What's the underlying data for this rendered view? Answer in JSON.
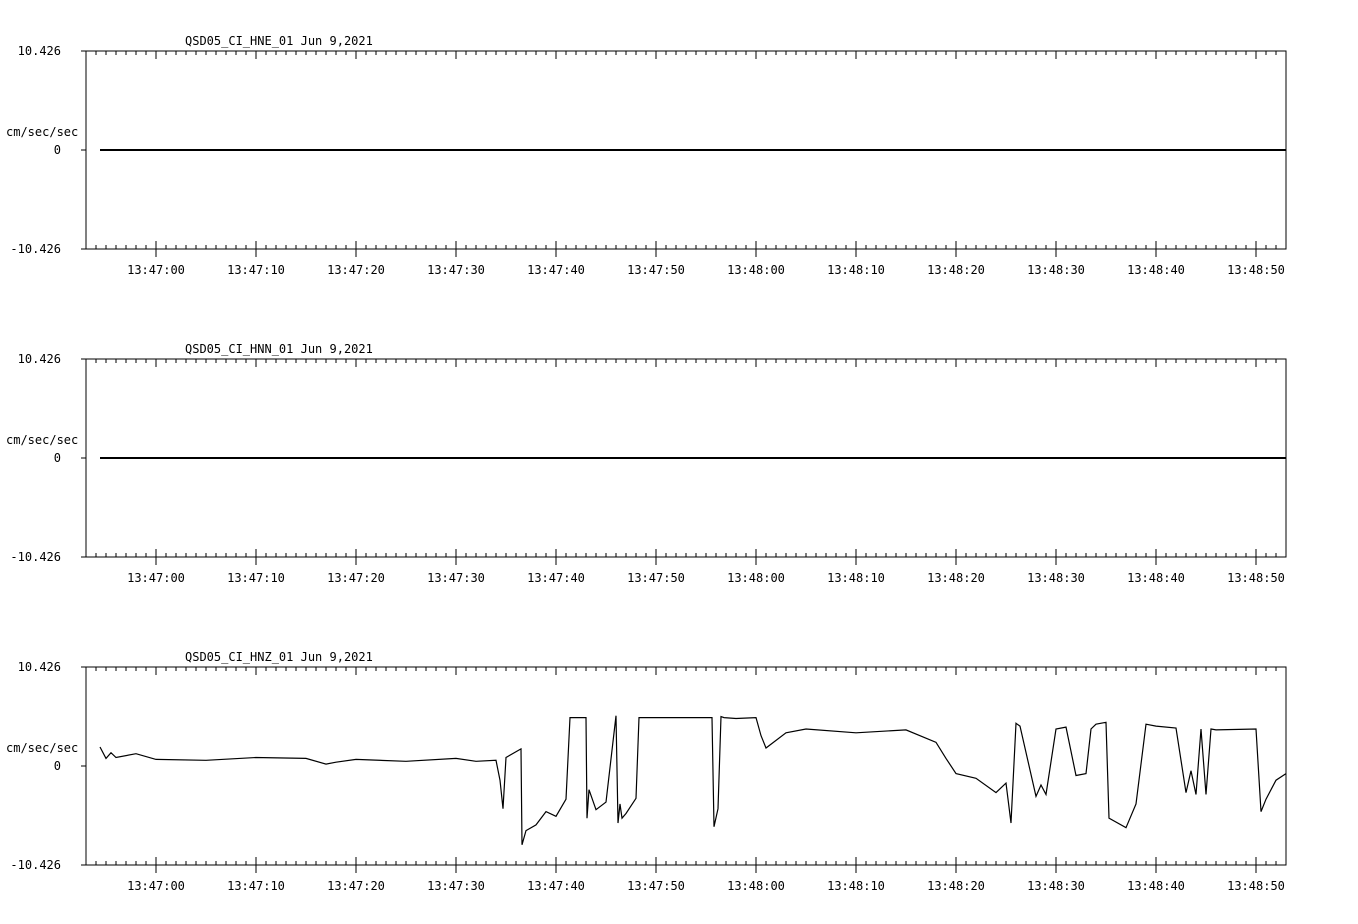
{
  "chart_data": [
    {
      "type": "line",
      "title": "QSD05_CI_HNE_01  Jun 9,2021",
      "ylabel": "cm/sec/sec",
      "ylim": [
        -10.426,
        10.426
      ],
      "ytick_labels": [
        "10.426",
        "0",
        "-10.426"
      ],
      "xlim": [
        "13:46:53",
        "13:48:53"
      ],
      "xtick_labels": [
        "13:47:00",
        "13:47:10",
        "13:47:20",
        "13:47:30",
        "13:47:40",
        "13:47:50",
        "13:48:00",
        "13:48:10",
        "13:48:20",
        "13:48:30",
        "13:48:40",
        "13:48:50"
      ],
      "series": [
        {
          "x": [
            "13:46:54.4",
            "13:48:53"
          ],
          "values": [
            0,
            0
          ],
          "color": "#000000"
        }
      ]
    },
    {
      "type": "line",
      "title": "QSD05_CI_HNN_01  Jun 9,2021",
      "ylabel": "cm/sec/sec",
      "ylim": [
        -10.426,
        10.426
      ],
      "ytick_labels": [
        "10.426",
        "0",
        "-10.426"
      ],
      "xlim": [
        "13:46:53",
        "13:48:53"
      ],
      "xtick_labels": [
        "13:47:00",
        "13:47:10",
        "13:47:20",
        "13:47:30",
        "13:47:40",
        "13:47:50",
        "13:48:00",
        "13:48:10",
        "13:48:20",
        "13:48:30",
        "13:48:40",
        "13:48:50"
      ],
      "series": [
        {
          "x": [
            "13:46:54.4",
            "13:48:53"
          ],
          "values": [
            0,
            0
          ],
          "color": "#000000"
        }
      ]
    },
    {
      "type": "line",
      "title": "QSD05_CI_HNZ_01  Jun 9,2021",
      "ylabel": "cm/sec/sec",
      "ylim": [
        -10.426,
        10.426
      ],
      "ytick_labels": [
        "10.426",
        "0",
        "-10.426"
      ],
      "xlim": [
        "13:46:53",
        "13:48:53"
      ],
      "xtick_labels": [
        "13:47:00",
        "13:47:10",
        "13:47:20",
        "13:47:30",
        "13:47:40",
        "13:47:50",
        "13:48:00",
        "13:48:10",
        "13:48:20",
        "13:48:30",
        "13:48:40",
        "13:48:50"
      ],
      "series": [
        {
          "color": "#000000",
          "x": [
            "13:46:54.4",
            "13:46:55",
            "13:46:55.5",
            "13:46:56",
            "13:46:58",
            "13:47:00",
            "13:47:05",
            "13:47:10",
            "13:47:15",
            "13:47:17",
            "13:47:18",
            "13:47:20",
            "13:47:25",
            "13:47:30",
            "13:47:32",
            "13:47:34",
            "13:47:34.4",
            "13:47:34.7",
            "13:47:35",
            "13:47:36.5",
            "13:47:36.6",
            "13:47:37",
            "13:47:38",
            "13:47:39",
            "13:47:40",
            "13:47:41",
            "13:47:41.4",
            "13:47:41.5",
            "13:47:43",
            "13:47:43.1",
            "13:47:43.3",
            "13:47:44",
            "13:47:45",
            "13:47:46",
            "13:47:46.2",
            "13:47:46.4",
            "13:47:46.6",
            "13:47:47",
            "13:47:48",
            "13:47:48.3",
            "13:47:50",
            "13:47:55",
            "13:47:55.6",
            "13:47:55.8",
            "13:47:56.2",
            "13:47:56.5",
            "13:47:56.8",
            "13:47:58",
            "13:48:00",
            "13:48:00.5",
            "13:48:01",
            "13:48:03",
            "13:48:05",
            "13:48:10",
            "13:48:15",
            "13:48:18",
            "13:48:19",
            "13:48:20",
            "13:48:22",
            "13:48:24",
            "13:48:25",
            "13:48:25.5",
            "13:48:26",
            "13:48:26.4",
            "13:48:28",
            "13:48:28.5",
            "13:48:29",
            "13:48:30",
            "13:48:31",
            "13:48:32",
            "13:48:33",
            "13:48:33.5",
            "13:48:34",
            "13:48:35",
            "13:48:35.3",
            "13:48:37",
            "13:48:38",
            "13:48:39",
            "13:48:40",
            "13:48:42",
            "13:48:43",
            "13:48:43.5",
            "13:48:44",
            "13:48:44.5",
            "13:48:45",
            "13:48:45.5",
            "13:48:46",
            "13:48:50",
            "13:48:50.5",
            "13:48:51",
            "13:48:52",
            "13:48:53"
          ],
          "values": [
            2.0,
            0.8,
            1.4,
            0.9,
            1.3,
            0.7,
            0.6,
            0.9,
            0.8,
            0.2,
            0.4,
            0.7,
            0.5,
            0.8,
            0.5,
            0.6,
            -1.5,
            -4.5,
            0.9,
            1.8,
            -8.3,
            -6.8,
            -6.2,
            -4.8,
            -5.3,
            -3.5,
            5.1,
            5.1,
            5.1,
            -5.5,
            -2.5,
            -4.6,
            -3.8,
            5.3,
            -6.0,
            -4.0,
            -5.5,
            -5.0,
            -3.4,
            5.1,
            5.1,
            5.1,
            5.1,
            -6.4,
            -4.5,
            5.2,
            5.1,
            5.0,
            5.1,
            3.2,
            1.9,
            3.5,
            3.9,
            3.5,
            3.8,
            2.5,
            0.8,
            -0.8,
            -1.3,
            -2.8,
            -1.8,
            -6.0,
            4.5,
            4.2,
            -3.2,
            -2.0,
            -3.0,
            3.9,
            4.1,
            -1.0,
            -0.8,
            3.9,
            4.4,
            4.6,
            -5.5,
            -6.5,
            -4.0,
            4.4,
            4.2,
            4.0,
            -2.8,
            -0.5,
            -3.0,
            3.9,
            -3.0,
            3.9,
            3.8,
            3.9,
            -4.8,
            -3.5,
            -1.5,
            -0.8
          ]
        }
      ]
    }
  ]
}
